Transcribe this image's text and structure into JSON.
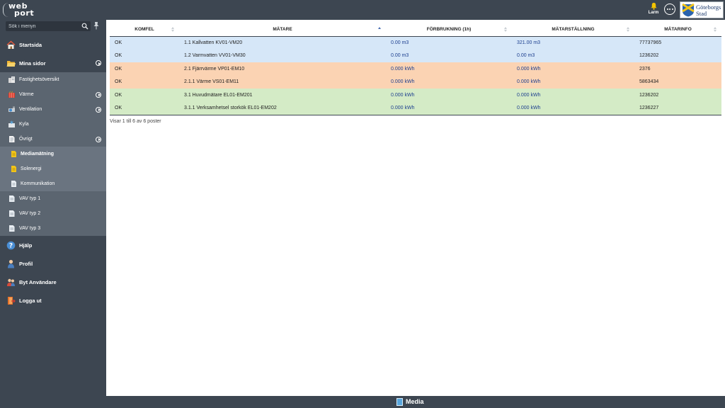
{
  "app": {
    "logo_line1": "web",
    "logo_line2": "port"
  },
  "header": {
    "alarm_label": "Larm",
    "organization": {
      "line1": "Göteborgs",
      "line2": "Stad"
    }
  },
  "sidebar": {
    "search_placeholder": "Sök i menyn",
    "main_items": [
      {
        "label": "Startsida",
        "icon": "house-icon"
      },
      {
        "label": "Mina sidor",
        "icon": "folder-icon",
        "expandable": true
      }
    ],
    "mina_sidor_children": [
      {
        "label": "Fastighetsöversikt",
        "icon": "building-icon"
      },
      {
        "label": "Värme",
        "icon": "heating-icon",
        "expandable": true
      },
      {
        "label": "Ventilation",
        "icon": "ventilation-icon",
        "expandable": true
      },
      {
        "label": "Kyla",
        "icon": "cooling-icon"
      },
      {
        "label": "Övrigt",
        "icon": "document-icon",
        "expandable": true
      }
    ],
    "ovrigt_children": [
      {
        "label": "Mediamätning",
        "icon": "page-icon",
        "active": true
      },
      {
        "label": "Solenergi",
        "icon": "page-icon"
      },
      {
        "label": "Kommunikation",
        "icon": "page-icon"
      }
    ],
    "vav_items": [
      {
        "label": "VAV typ 1",
        "icon": "page-icon"
      },
      {
        "label": "VAV typ 2",
        "icon": "page-icon"
      },
      {
        "label": "VAV typ 3",
        "icon": "page-icon"
      }
    ],
    "bottom_items": [
      {
        "label": "Hjälp",
        "icon": "help-icon"
      },
      {
        "label": "Profil",
        "icon": "user-icon"
      },
      {
        "label": "Byt Användare",
        "icon": "switch-user-icon"
      },
      {
        "label": "Logga ut",
        "icon": "logout-icon"
      }
    ]
  },
  "table": {
    "columns": [
      "KOMFEL",
      "MÄTARE",
      "FÖRBRUKNING (1h)",
      "MÄTARSTÄLLNING",
      "MÄTARINFO"
    ],
    "sorted_column_index": 1,
    "rows": [
      {
        "komfel": "OK",
        "matare": "1.1 Kallvatten KV01-VM20",
        "forbrukning": "0.00 m3",
        "matarstallning": "321.00 m3",
        "matarinfo": "77737965",
        "color": "#d6e7f8"
      },
      {
        "komfel": "OK",
        "matare": "1.2 Varmvatten VV01-VM30",
        "forbrukning": "0.00 m3",
        "matarstallning": "0.00 m3",
        "matarinfo": "1236202",
        "color": "#d6e7f8"
      },
      {
        "komfel": "OK",
        "matare": "2.1 Fjärrvärme VP01-EM10",
        "forbrukning": "0.000 kWh",
        "matarstallning": "0.000 kWh",
        "matarinfo": "2376",
        "color": "#fbd3b3"
      },
      {
        "komfel": "OK",
        "matare": "2.1.1 Värme VS01-EM11",
        "forbrukning": "0.000 kWh",
        "matarstallning": "0.000 kWh",
        "matarinfo": "5863434",
        "color": "#fbd3b3"
      },
      {
        "komfel": "OK",
        "matare": "3.1 Huvudmätare EL01-EM201",
        "forbrukning": "0.000 kWh",
        "matarstallning": "0.000 kWh",
        "matarinfo": "1236202",
        "color": "#d4ebc6"
      },
      {
        "komfel": "OK",
        "matare": "3.1.1 Verksamhetsel storkök EL01-EM202",
        "forbrukning": "0.000 kWh",
        "matarstallning": "0.000 kWh",
        "matarinfo": "1236227",
        "color": "#d4ebc6"
      }
    ],
    "info_text": "Visar 1 till 6 av 6 poster"
  },
  "footer": {
    "title": "Media"
  }
}
